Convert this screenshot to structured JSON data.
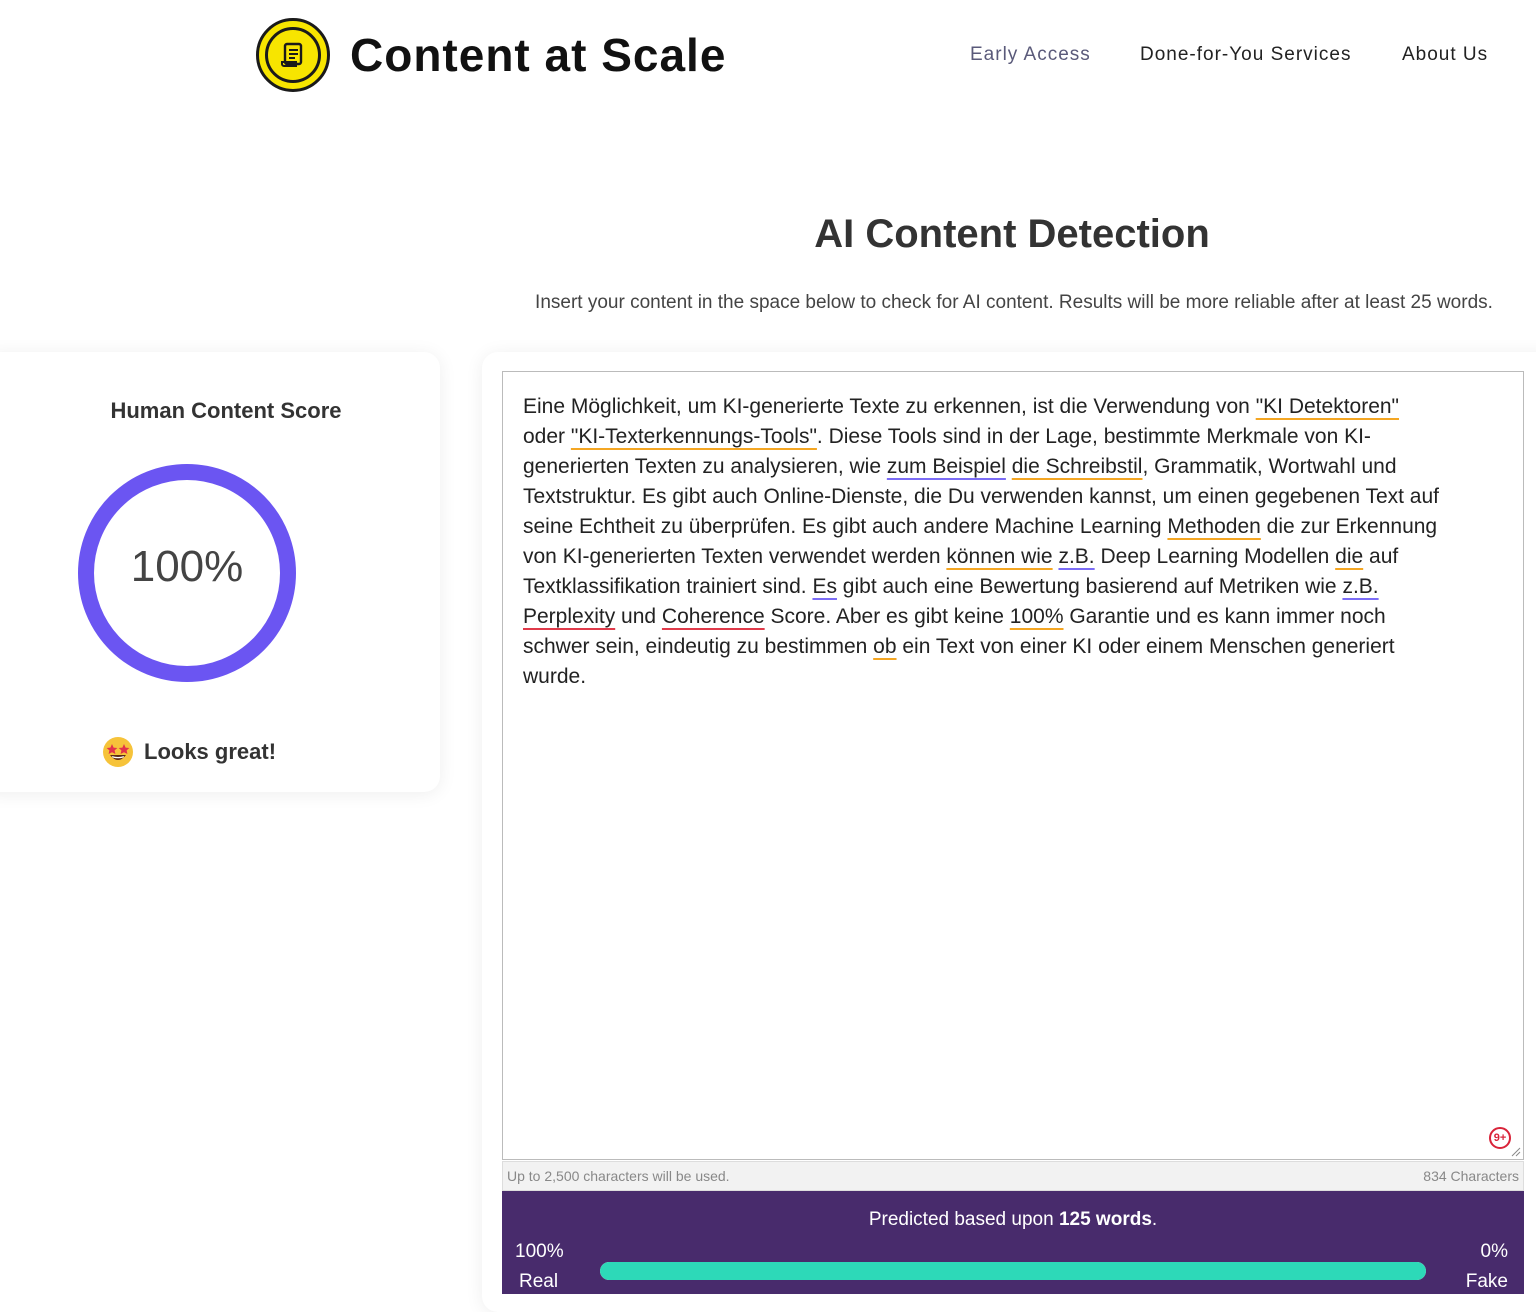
{
  "header": {
    "brand": "Content at Scale",
    "brand_color": "#f7e500",
    "nav": [
      {
        "label": "Early Access",
        "active": true
      },
      {
        "label": "Done-for-You Services",
        "active": false
      },
      {
        "label": "About Us",
        "active": false
      }
    ]
  },
  "main": {
    "title": "AI Content Detection",
    "subtitle": "Insert your content in the space below to check for AI content. Results will be more reliable after at least 25 words."
  },
  "score_card": {
    "title": "Human Content Score",
    "value": "100%",
    "value_fraction": 1.0,
    "ring_color": "#6b55f2",
    "status_emoji": "star-struck-emoji",
    "status": "Looks great!"
  },
  "editor": {
    "badge": "9+",
    "char_limit_note": "Up to 2,500 characters will be used.",
    "char_count": "834 Characters",
    "lines": [
      [
        {
          "t": "Eine Möglichkeit, um KI-generierte Texte zu erkennen, ist die Verwendung von "
        },
        {
          "t": "\"KI Detektoren\"",
          "u": "o"
        }
      ],
      [
        {
          "t": "oder "
        },
        {
          "t": "\"KI-Texterkennungs-Tools\"",
          "u": "o"
        },
        {
          "t": ". Diese Tools sind in der Lage, bestimmte Merkmale von KI-"
        }
      ],
      [
        {
          "t": "generierten Texten zu analysieren, wie "
        },
        {
          "t": "zum Beispiel",
          "u": "p"
        },
        {
          "t": " "
        },
        {
          "t": "die Schreibstil",
          "u": "o"
        },
        {
          "t": ", Grammatik, Wortwahl und"
        }
      ],
      [
        {
          "t": "Textstruktur. Es gibt auch Online-Dienste, die Du verwenden kannst, um einen gegebenen Text auf"
        }
      ],
      [
        {
          "t": "seine Echtheit zu überprüfen. Es gibt auch andere Machine Learning "
        },
        {
          "t": "Methoden",
          "u": "o"
        },
        {
          "t": " die zur Erkennung"
        }
      ],
      [
        {
          "t": "von KI-generierten Texten verwendet werden "
        },
        {
          "t": "können wie",
          "u": "o"
        },
        {
          "t": " "
        },
        {
          "t": "z.B.",
          "u": "p"
        },
        {
          "t": " Deep Learning Modellen "
        },
        {
          "t": "die",
          "u": "o"
        },
        {
          "t": " auf"
        }
      ],
      [
        {
          "t": "Textklassifikation trainiert sind. "
        },
        {
          "t": "Es",
          "u": "p"
        },
        {
          "t": " gibt auch eine Bewertung basierend auf Metriken wie "
        },
        {
          "t": "z.B.",
          "u": "p"
        }
      ],
      [
        {
          "t": "Perplexity",
          "u": "r"
        },
        {
          "t": " und "
        },
        {
          "t": "Coherence",
          "u": "r"
        },
        {
          "t": " Score. Aber es gibt keine "
        },
        {
          "t": "100%",
          "u": "o"
        },
        {
          "t": " Garantie und es kann immer noch"
        }
      ],
      [
        {
          "t": "schwer sein, eindeutig zu bestimmen "
        },
        {
          "t": "ob",
          "u": "o"
        },
        {
          "t": " ein Text von einer KI oder einem Menschen generiert"
        }
      ],
      [
        {
          "t": "wurde."
        }
      ]
    ]
  },
  "result": {
    "predicted_prefix": "Predicted based upon ",
    "predicted_words": "125 words",
    "predicted_suffix": ".",
    "real_pct": "100%",
    "real_label": "Real",
    "fake_pct": "0%",
    "fake_label": "Fake",
    "real_fraction": 1.0,
    "bar_color": "#2dd9b8",
    "panel_color": "#482b6c"
  }
}
